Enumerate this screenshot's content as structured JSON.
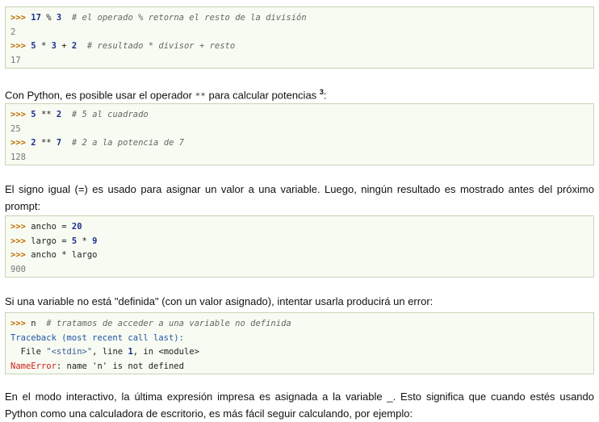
{
  "block1": {
    "l1_prompt": ">>>",
    "l1_a": "17",
    "l1_op": " % ",
    "l1_b": "3",
    "l1_comment": "# el operado % retorna el resto de la división",
    "l2_out": "2",
    "l3_prompt": ">>>",
    "l3_a": "5",
    "l3_op1": " * ",
    "l3_b": "3",
    "l3_op2": " + ",
    "l3_c": "2",
    "l3_comment": "# resultado * divisor + resto",
    "l4_out": "17"
  },
  "para1": {
    "text": "Con Python, es posible usar el operador",
    "code": "**",
    "text2": "para calcular potencias",
    "sup": "3",
    "end": ":"
  },
  "block2": {
    "l1_prompt": ">>>",
    "l1_a": "5",
    "l1_op": " ** ",
    "l1_b": "2",
    "l1_comment": "# 5 al cuadrado",
    "l2_out": "25",
    "l3_prompt": ">>>",
    "l3_a": "2",
    "l3_op": " ** ",
    "l3_b": "7",
    "l3_comment": "# 2 a la potencia de 7",
    "l4_out": "128"
  },
  "para2": {
    "text": "El signo igual (=) es usado para asignar un valor a una variable. Luego, ningún resultado es mostrado antes del próximo prompt:"
  },
  "block3": {
    "l1_prompt": ">>>",
    "l1_var": "ancho = ",
    "l1_val": "20",
    "l2_prompt": ">>>",
    "l2_var": "largo = ",
    "l2_a": "5",
    "l2_op": " * ",
    "l2_b": "9",
    "l3_prompt": ">>>",
    "l3_expr": "ancho * largo",
    "l4_out": "900"
  },
  "para3": {
    "text": "Si una variable no está \"definida\" (con un valor asignado), intentar usarla producirá un error:"
  },
  "block4": {
    "l1_prompt": ">>>",
    "l1_var": "n",
    "l1_comment": "# tratamos de acceder a una variable no definida",
    "l2_traceback": "Traceback (most recent call last):",
    "l3_a": "File ",
    "l3_str": "\"<stdin>\"",
    "l3_b": ", line ",
    "l3_num": "1",
    "l3_c": ", in <module>",
    "l4_err": "NameError",
    "l4_msg": ": name 'n' is not defined"
  },
  "para4": {
    "text": "En el modo interactivo, la última expresión impresa es asignada a la variable _. Esto significa que cuando estés usando Python como una calculadora de escritorio, es más fácil seguir calculando, por ejemplo:"
  }
}
